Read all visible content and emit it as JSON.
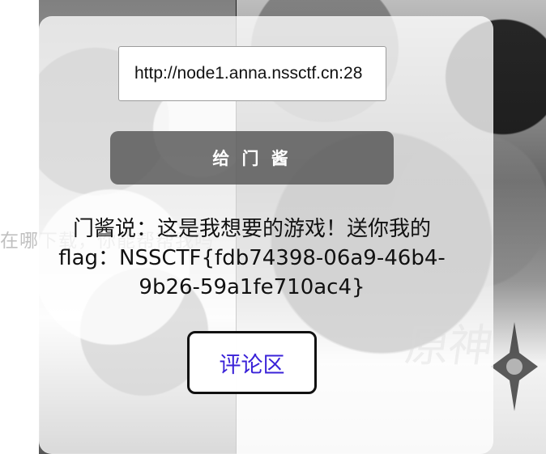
{
  "background": {
    "left_overflow_text": "在哪下载，你能帮帮我吗",
    "logo_text": "原神"
  },
  "form": {
    "url_value": "http://node1.anna.nssctf.cn:28",
    "submit_label": "给 门 酱"
  },
  "result": {
    "message": "门酱说：这是我想要的游戏！送你我的flag：NSSCTF{fdb74398-06a9-46b4-9b26-59a1fe710ac4}"
  },
  "links": {
    "comment_label": "评论区"
  },
  "colors": {
    "button_background": "#555555",
    "link_text": "#3a22d8",
    "overlay": "#ffffff"
  },
  "icons": {
    "logo_star": "star-logo-icon"
  }
}
